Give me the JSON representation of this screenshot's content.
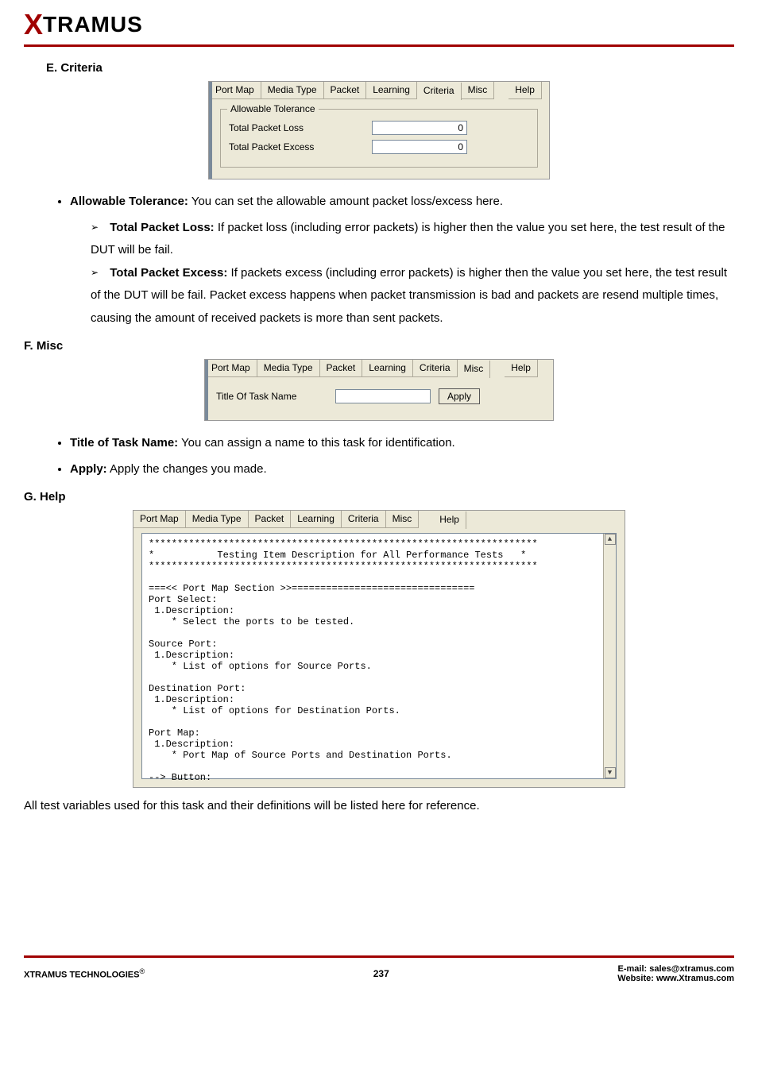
{
  "brand": {
    "x": "X",
    "name": "TRAMUS"
  },
  "sections": {
    "criteria": {
      "title": "E. Criteria"
    },
    "misc": {
      "title": "F. Misc"
    },
    "help": {
      "title": "G. Help"
    }
  },
  "tabs": {
    "portMap": "Port Map",
    "mediaType": "Media Type",
    "packet": "Packet",
    "learning": "Learning",
    "criteria": "Criteria",
    "misc": "Misc",
    "help": "Help"
  },
  "criteria_box": {
    "group_title": "Allowable Tolerance",
    "loss_label": "Total Packet Loss",
    "loss_value": "0",
    "excess_label": "Total Packet Excess",
    "excess_value": "0"
  },
  "misc_box": {
    "title_label": "Title Of Task Name",
    "title_value": "",
    "apply_label": "Apply"
  },
  "prose": {
    "allowable_title": "Allowable Tolerance:",
    "allowable_text": " You can set the allowable amount packet loss/excess here.",
    "loss_title": "Total Packet Loss:",
    "loss_text": " If packet loss (including error packets) is higher then the value you set here, the test result of the DUT will be fail.",
    "excess_title": "Total Packet Excess:",
    "excess_text": " If packets excess (including error packets) is higher then the value you set here, the test result of the DUT will be fail. Packet excess happens when packet transmission is bad and packets are resend multiple times, causing the amount of received packets is more than sent packets.",
    "title_of_task_title": "Title of Task Name:",
    "title_of_task_text": " You can assign a name to this task for identification.",
    "apply_title": "Apply:",
    "apply_text": " Apply the changes you made."
  },
  "help_text": "********************************************************************\n*           Testing Item Description for All Performance Tests   *\n********************************************************************\n\n===<< Port Map Section >>================================\nPort Select:\n 1.Description:\n    * Select the ports to be tested.\n\nSource Port:\n 1.Description:\n    * List of options for Source Ports.\n\nDestination Port:\n 1.Description:\n    * List of options for Destination Ports.\n\nPort Map:\n 1.Description:\n    * Port Map of Source Ports and Destination Ports.\n\n--> Button:",
  "help_footer_note": "All test variables used for this task and their definitions will be listed here for reference.",
  "footer": {
    "company": "XTRAMUS TECHNOLOGIES",
    "reg": "®",
    "page": "237",
    "email_label": "E-mail: ",
    "email": "sales@xtramus.com",
    "web_label": "Website:  ",
    "web": "www.Xtramus.com"
  }
}
